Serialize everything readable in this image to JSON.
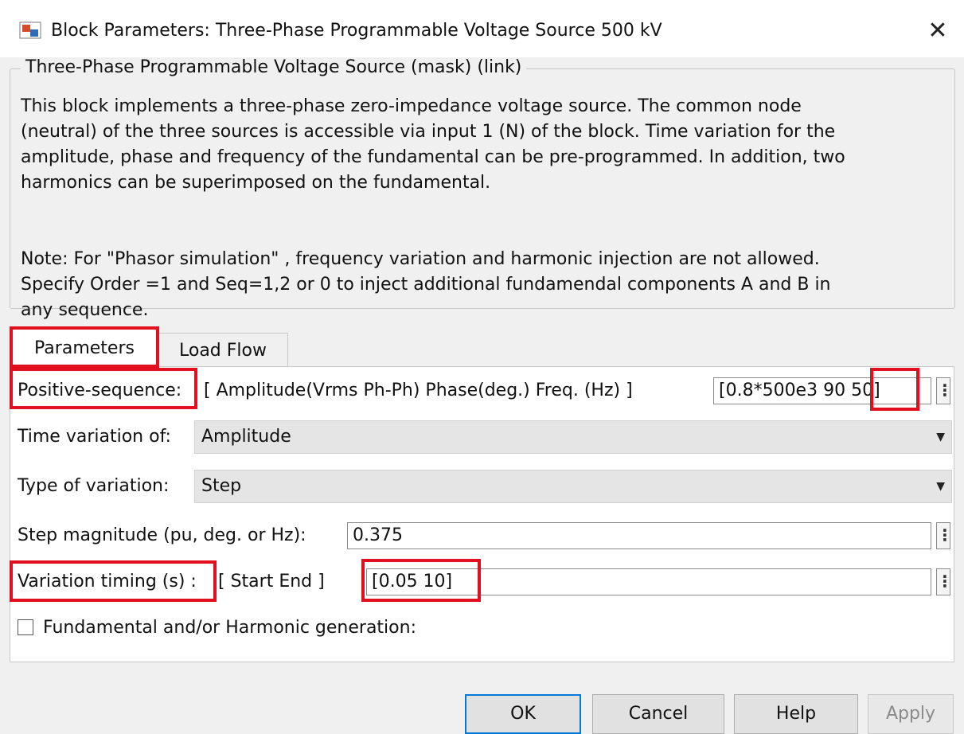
{
  "window": {
    "title": "Block Parameters: Three-Phase Programmable Voltage Source 500 kV",
    "close_glyph": "✕"
  },
  "group": {
    "title": "Three-Phase Programmable Voltage Source (mask) (link)",
    "description": "This block implements a three-phase zero-impedance voltage source. The common node\n(neutral) of the three sources is accessible via input 1 (N) of the block. Time variation for the\namplitude, phase and frequency of the fundamental can be pre-programmed. In addition, two\nharmonics can be superimposed on the fundamental.",
    "note": "Note: For  \"Phasor simulation\" , frequency variation and harmonic injection are not allowed.\nSpecify  Order =1 and Seq=1,2 or 0 to inject additional fundamendal components A and B in\nany sequence."
  },
  "tabs": [
    {
      "label": "Parameters",
      "active": true
    },
    {
      "label": "Load Flow",
      "active": false
    }
  ],
  "params": {
    "positive_sequence": {
      "label": "Positive-sequence:",
      "hint": "[ Amplitude(Vrms Ph-Ph)  Phase(deg.)   Freq. (Hz) ]",
      "value": "[0.8*500e3  90 50]"
    },
    "time_variation": {
      "label": "Time variation of:",
      "selected": "Amplitude"
    },
    "type_variation": {
      "label": "Type of variation:",
      "selected": "Step"
    },
    "step_magnitude": {
      "label": "Step magnitude (pu, deg. or Hz):",
      "value": "0.375"
    },
    "variation_timing": {
      "label": "Variation timing (s) :",
      "hint": "[ Start   End ]",
      "value": "[0.05 10]"
    },
    "harmonic_generation": {
      "label": "Fundamental and/or Harmonic generation:",
      "checked": false
    },
    "more_glyph": "⋮"
  },
  "buttons": {
    "ok": "OK",
    "cancel": "Cancel",
    "help": "Help",
    "apply": "Apply"
  },
  "colors": {
    "highlight": "#e0101e",
    "ok_border": "#0078d7"
  },
  "icons": [
    "simulink-block-icon",
    "close-icon",
    "chevron-down-icon",
    "more-options-icon",
    "checkbox-icon"
  ]
}
